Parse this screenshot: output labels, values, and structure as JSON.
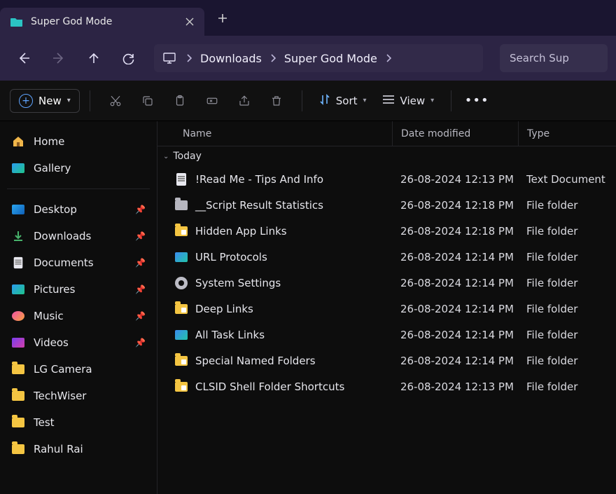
{
  "tab": {
    "title": "Super God Mode"
  },
  "breadcrumbs": [
    "Downloads",
    "Super God Mode"
  ],
  "search_placeholder": "Search Sup",
  "toolbar": {
    "new": "New",
    "sort": "Sort",
    "view": "View"
  },
  "columns": {
    "name": "Name",
    "date": "Date modified",
    "type": "Type"
  },
  "group": {
    "label": "Today"
  },
  "sidebar": {
    "top": [
      {
        "label": "Home",
        "icon": "home"
      },
      {
        "label": "Gallery",
        "icon": "gallery"
      }
    ],
    "pinned": [
      {
        "label": "Desktop",
        "icon": "desktop",
        "pin": true
      },
      {
        "label": "Downloads",
        "icon": "download",
        "pin": true
      },
      {
        "label": "Documents",
        "icon": "docs",
        "pin": true
      },
      {
        "label": "Pictures",
        "icon": "pictures",
        "pin": true
      },
      {
        "label": "Music",
        "icon": "music",
        "pin": true
      },
      {
        "label": "Videos",
        "icon": "videos",
        "pin": true
      },
      {
        "label": "LG Camera",
        "icon": "folder",
        "pin": false
      },
      {
        "label": "TechWiser",
        "icon": "folder",
        "pin": false
      },
      {
        "label": "Test",
        "icon": "folder",
        "pin": false
      },
      {
        "label": "Rahul Rai",
        "icon": "folder",
        "pin": false
      }
    ]
  },
  "files": [
    {
      "name": "!Read Me - Tips And Info",
      "date": "26-08-2024 12:13 PM",
      "type": "Text Document",
      "icon": "doc"
    },
    {
      "name": "__Script Result Statistics",
      "date": "26-08-2024 12:18 PM",
      "type": "File folder",
      "icon": "folder-gray"
    },
    {
      "name": "Hidden App Links",
      "date": "26-08-2024 12:18 PM",
      "type": "File folder",
      "icon": "folder-tag"
    },
    {
      "name": "URL Protocols",
      "date": "26-08-2024 12:14 PM",
      "type": "File folder",
      "icon": "thumb"
    },
    {
      "name": "System Settings",
      "date": "26-08-2024 12:14 PM",
      "type": "File folder",
      "icon": "gear"
    },
    {
      "name": "Deep Links",
      "date": "26-08-2024 12:14 PM",
      "type": "File folder",
      "icon": "folder-tag"
    },
    {
      "name": "All Task Links",
      "date": "26-08-2024 12:14 PM",
      "type": "File folder",
      "icon": "thumb"
    },
    {
      "name": "Special Named Folders",
      "date": "26-08-2024 12:14 PM",
      "type": "File folder",
      "icon": "folder-tag"
    },
    {
      "name": "CLSID Shell Folder Shortcuts",
      "date": "26-08-2024 12:13 PM",
      "type": "File folder",
      "icon": "folder-tag"
    }
  ]
}
